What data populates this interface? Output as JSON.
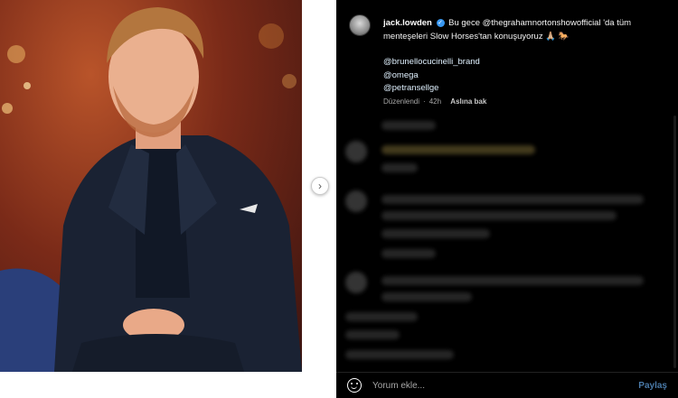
{
  "post": {
    "username": "jack.lowden",
    "caption": "Bu gece @thegrahamnortonshowofficial 'da tüm menteşeleri Slow Horses'tan konuşuyoruz 🙏🏼 🐎",
    "mentions": [
      "@brunellocucinelli_brand",
      "@omega",
      "@petransellge"
    ],
    "edited_label": "Düzenlendi",
    "time": "42h",
    "translate_label": "Aslına bak"
  },
  "comment_box": {
    "placeholder": "Yorum ekle...",
    "share_label": "Paylaş"
  },
  "icons": {
    "next": "chevron-right-icon",
    "verified": "verified-badge-icon",
    "emoji": "emoji-icon"
  },
  "colors": {
    "pane_bg": "#000000",
    "verified": "#3897f0",
    "share": "#4a7aa8"
  }
}
